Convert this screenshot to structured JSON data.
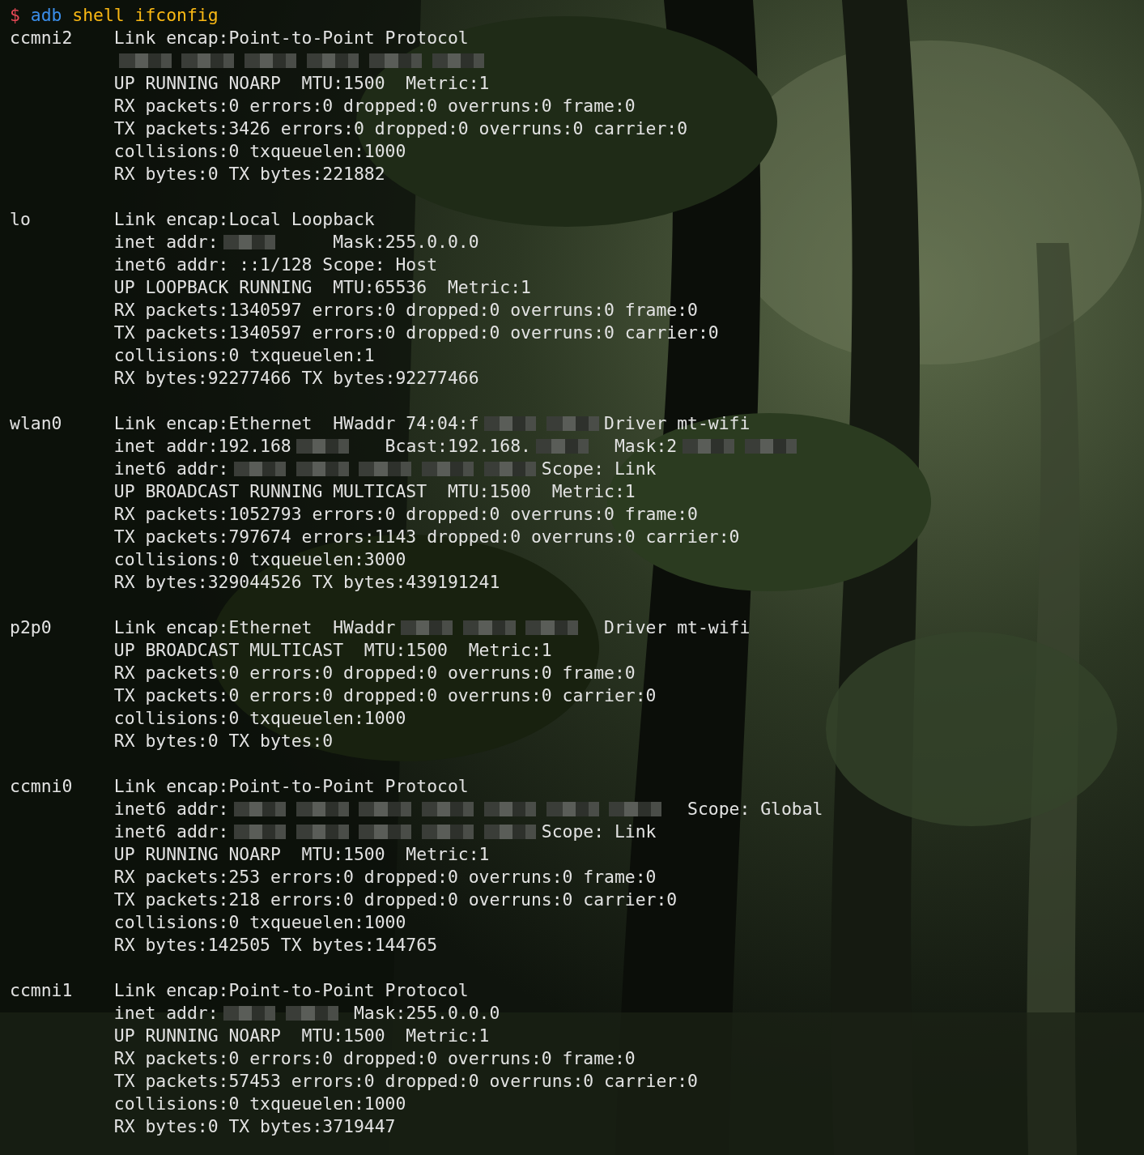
{
  "prompt": [
    {
      "text": "$",
      "color": "#e74856"
    },
    {
      "text": "adb",
      "color": "#3b8eea"
    },
    {
      "text": "shell ifconfig",
      "color": "#f9b814"
    }
  ],
  "interfaces": [
    {
      "name": "ccmni2",
      "lines": [
        "Link encap:Point-to-Point Protocol",
        [
          {
            "kind": "redacted"
          },
          {
            "kind": "redacted"
          },
          {
            "kind": "redacted"
          },
          {
            "kind": "redacted"
          },
          {
            "kind": "redacted"
          },
          {
            "kind": "redacted"
          }
        ],
        "UP RUNNING NOARP  MTU:1500  Metric:1",
        "RX packets:0 errors:0 dropped:0 overruns:0 frame:0",
        "TX packets:3426 errors:0 dropped:0 overruns:0 carrier:0",
        "collisions:0 txqueuelen:1000",
        "RX bytes:0 TX bytes:221882"
      ]
    },
    {
      "name": "lo",
      "lines": [
        "Link encap:Local Loopback",
        [
          {
            "kind": "text",
            "text": "inet addr:"
          },
          {
            "kind": "redacted"
          },
          {
            "kind": "text",
            "text": "     Mask:255.0.0.0"
          }
        ],
        "inet6 addr: ::1/128 Scope: Host",
        "UP LOOPBACK RUNNING  MTU:65536  Metric:1",
        "RX packets:1340597 errors:0 dropped:0 overruns:0 frame:0",
        "TX packets:1340597 errors:0 dropped:0 overruns:0 carrier:0",
        "collisions:0 txqueuelen:1",
        "RX bytes:92277466 TX bytes:92277466"
      ]
    },
    {
      "name": "wlan0",
      "lines": [
        [
          {
            "kind": "text",
            "text": "Link encap:Ethernet  HWaddr 74:04:f"
          },
          {
            "kind": "redacted"
          },
          {
            "kind": "redacted"
          },
          {
            "kind": "text",
            "text": "Driver mt-wifi"
          }
        ],
        [
          {
            "kind": "text",
            "text": "inet addr:192.168"
          },
          {
            "kind": "redacted"
          },
          {
            "kind": "text",
            "text": "   Bcast:192.168."
          },
          {
            "kind": "redacted"
          },
          {
            "kind": "text",
            "text": "  Mask:2"
          },
          {
            "kind": "redacted"
          },
          {
            "kind": "redacted"
          }
        ],
        [
          {
            "kind": "text",
            "text": "inet6 addr:"
          },
          {
            "kind": "redacted"
          },
          {
            "kind": "redacted"
          },
          {
            "kind": "redacted"
          },
          {
            "kind": "redacted"
          },
          {
            "kind": "redacted"
          },
          {
            "kind": "text",
            "text": "Scope: Link"
          }
        ],
        "UP BROADCAST RUNNING MULTICAST  MTU:1500  Metric:1",
        "RX packets:1052793 errors:0 dropped:0 overruns:0 frame:0",
        "TX packets:797674 errors:1143 dropped:0 overruns:0 carrier:0",
        "collisions:0 txqueuelen:3000",
        "RX bytes:329044526 TX bytes:439191241"
      ]
    },
    {
      "name": "p2p0",
      "lines": [
        [
          {
            "kind": "text",
            "text": "Link encap:Ethernet  HWaddr"
          },
          {
            "kind": "redacted"
          },
          {
            "kind": "redacted"
          },
          {
            "kind": "redacted"
          },
          {
            "kind": "text",
            "text": "  Driver mt-wifi"
          }
        ],
        "UP BROADCAST MULTICAST  MTU:1500  Metric:1",
        "RX packets:0 errors:0 dropped:0 overruns:0 frame:0",
        "TX packets:0 errors:0 dropped:0 overruns:0 carrier:0",
        "collisions:0 txqueuelen:1000",
        "RX bytes:0 TX bytes:0"
      ]
    },
    {
      "name": "ccmni0",
      "lines": [
        "Link encap:Point-to-Point Protocol",
        [
          {
            "kind": "text",
            "text": "inet6 addr:"
          },
          {
            "kind": "redacted"
          },
          {
            "kind": "redacted"
          },
          {
            "kind": "redacted"
          },
          {
            "kind": "redacted"
          },
          {
            "kind": "redacted"
          },
          {
            "kind": "redacted"
          },
          {
            "kind": "redacted"
          },
          {
            "kind": "text",
            "text": "  Scope: Global"
          }
        ],
        [
          {
            "kind": "text",
            "text": "inet6 addr:"
          },
          {
            "kind": "redacted"
          },
          {
            "kind": "redacted"
          },
          {
            "kind": "redacted"
          },
          {
            "kind": "redacted"
          },
          {
            "kind": "redacted"
          },
          {
            "kind": "text",
            "text": "Scope: Link"
          }
        ],
        "UP RUNNING NOARP  MTU:1500  Metric:1",
        "RX packets:253 errors:0 dropped:0 overruns:0 frame:0",
        "TX packets:218 errors:0 dropped:0 overruns:0 carrier:0",
        "collisions:0 txqueuelen:1000",
        "RX bytes:142505 TX bytes:144765"
      ]
    },
    {
      "name": "ccmni1",
      "lines": [
        "Link encap:Point-to-Point Protocol",
        [
          {
            "kind": "text",
            "text": "inet addr:"
          },
          {
            "kind": "redacted"
          },
          {
            "kind": "redacted"
          },
          {
            "kind": "text",
            "text": " Mask:255.0.0.0"
          }
        ],
        "UP RUNNING NOARP  MTU:1500  Metric:1",
        "RX packets:0 errors:0 dropped:0 overruns:0 frame:0",
        "TX packets:57453 errors:0 dropped:0 overruns:0 carrier:0",
        "collisions:0 txqueuelen:1000",
        "RX bytes:0 TX bytes:3719447"
      ]
    }
  ]
}
